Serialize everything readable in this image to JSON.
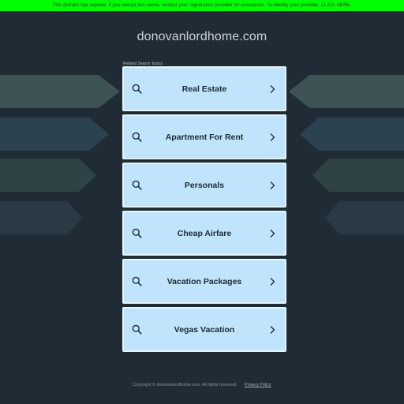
{
  "banner": {
    "text": "This domain has expired. If you owned this name, contact your registration provider for assistance. To identify your provider, CLICK HERE."
  },
  "header": {
    "domain": "donovanlordhome.com"
  },
  "related": {
    "label": "Related Search Topics",
    "items": [
      {
        "label": "Real Estate",
        "icon": "search-icon",
        "chevron": "chevron-right-icon"
      },
      {
        "label": "Apartment For Rent",
        "icon": "search-icon",
        "chevron": "chevron-right-icon"
      },
      {
        "label": "Personals",
        "icon": "search-icon",
        "chevron": "chevron-right-icon"
      },
      {
        "label": "Cheap Airfare",
        "icon": "search-icon",
        "chevron": "chevron-right-icon"
      },
      {
        "label": "Vacation Packages",
        "icon": "search-icon",
        "chevron": "chevron-right-icon"
      },
      {
        "label": "Vegas Vacation",
        "icon": "search-icon",
        "chevron": "chevron-right-icon"
      }
    ]
  },
  "footer": {
    "copyright": "Copyright © donovanlordhome.com.  All rights reserved.",
    "privacy_label": "Privacy Policy"
  },
  "colors": {
    "background": "#1f2b35",
    "banner": "#00ff00",
    "item_background": "#bfe4fb",
    "item_text": "#1c2a36"
  }
}
